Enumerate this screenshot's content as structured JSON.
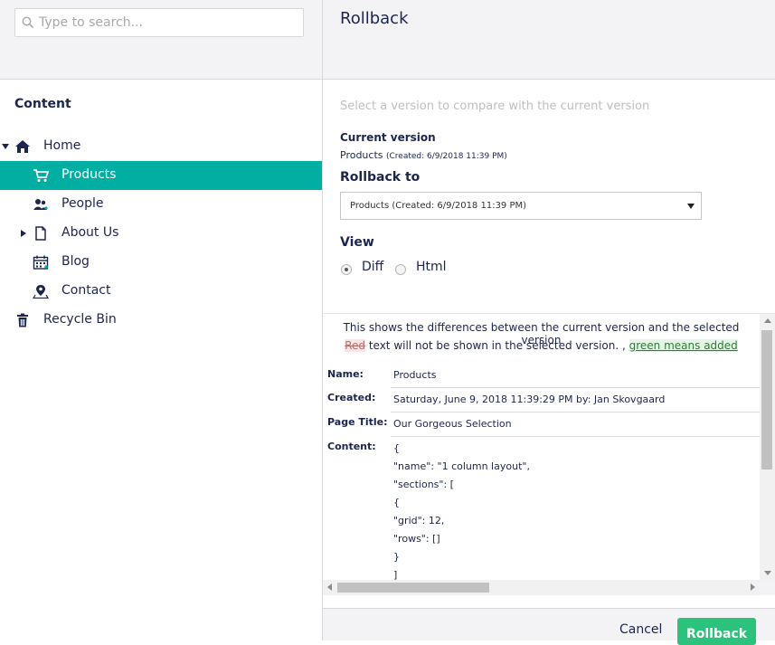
{
  "search": {
    "placeholder": "Type to search..."
  },
  "tree": {
    "section_title": "Content",
    "items": [
      {
        "label": "Home",
        "icon": "home-icon"
      },
      {
        "label": "Products",
        "icon": "cart-icon"
      },
      {
        "label": "People",
        "icon": "people-icon"
      },
      {
        "label": "About Us",
        "icon": "document-icon"
      },
      {
        "label": "Blog",
        "icon": "calendar-icon"
      },
      {
        "label": "Contact",
        "icon": "map-pin-icon"
      },
      {
        "label": "Recycle Bin",
        "icon": "trash-icon"
      }
    ]
  },
  "dialog": {
    "title": "Rollback",
    "intro": "Select a version to compare with the current version",
    "current_version_label": "Current version",
    "current_version_name": "Products",
    "current_version_created": "(Created: 6/9/2018 11:39 PM)",
    "rollback_to_label": "Rollback to",
    "rollback_to_value": "Products (Created: 6/9/2018 11:39 PM)",
    "view_label": "View",
    "view_options": [
      {
        "label": "Diff",
        "checked": true
      },
      {
        "label": "Html",
        "checked": false
      }
    ]
  },
  "diff": {
    "note1": "This shows the differences between the current version and the selected version",
    "note2_red_word": "Red",
    "note2_text": " text will not be shown in the selected version. , ",
    "note2_green": "green means added",
    "properties": [
      {
        "name": "Name:",
        "value": "Products"
      },
      {
        "name": "Created:",
        "value": "Saturday, June 9, 2018 11:39:29 PM by: Jan Skovgaard"
      },
      {
        "name": "Page Title:",
        "value": "Our Gorgeous Selection"
      },
      {
        "name": "Content:",
        "value": ""
      }
    ],
    "content_lines": [
      "{",
      "\"name\": \"1 column layout\",",
      "\"sections\": [",
      "{",
      "\"grid\": 12,",
      "\"rows\": []",
      "}",
      "]"
    ]
  },
  "footer": {
    "cancel_label": "Cancel",
    "rollback_label": "Rollback"
  },
  "colors": {
    "accent": "#00aea2",
    "primary_button": "#2bc37c",
    "text": "#1b264f"
  }
}
